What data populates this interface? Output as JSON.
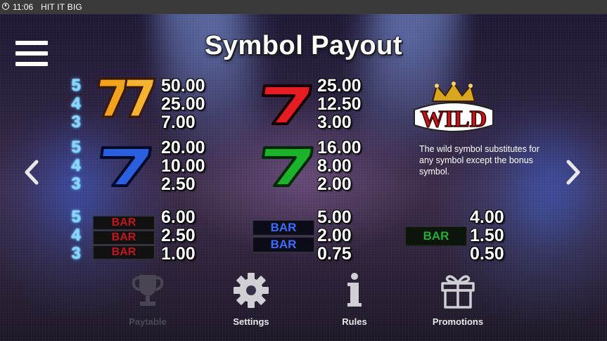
{
  "status_bar": {
    "time": "11:06",
    "app_name": "HIT IT BIG"
  },
  "title": "Symbol Payout",
  "multipliers": [
    "5",
    "4",
    "3"
  ],
  "symbols": {
    "gold_seven": {
      "payouts": [
        "50.00",
        "25.00",
        "7.00"
      ],
      "color": "#f2a21c"
    },
    "red_seven": {
      "payouts": [
        "25.00",
        "12.50",
        "3.00"
      ],
      "color": "#e51c22"
    },
    "blue_seven": {
      "payouts": [
        "20.00",
        "10.00",
        "2.50"
      ],
      "color": "#2a5fe0"
    },
    "green_seven": {
      "payouts": [
        "16.00",
        "8.00",
        "2.00"
      ],
      "color": "#1bb32a"
    },
    "triple_bar": {
      "label": "BAR",
      "payouts": [
        "6.00",
        "2.50",
        "1.00"
      ],
      "color": "#c4151a"
    },
    "double_bar": {
      "label": "BAR",
      "payouts": [
        "5.00",
        "2.00",
        "0.75"
      ],
      "color": "#2d56e6"
    },
    "single_bar": {
      "label": "BAR",
      "payouts": [
        "4.00",
        "1.50",
        "0.50"
      ],
      "color": "#1f9e2a"
    }
  },
  "wild": {
    "label": "WILD",
    "description": "The wild symbol substitutes for any symbol except the bonus symbol."
  },
  "nav": [
    {
      "label": "Paytable",
      "icon": "trophy-icon",
      "enabled": false
    },
    {
      "label": "Settings",
      "icon": "gear-icon",
      "enabled": true
    },
    {
      "label": "Rules",
      "icon": "info-icon",
      "enabled": true
    },
    {
      "label": "Promotions",
      "icon": "gift-icon",
      "enabled": true
    }
  ]
}
